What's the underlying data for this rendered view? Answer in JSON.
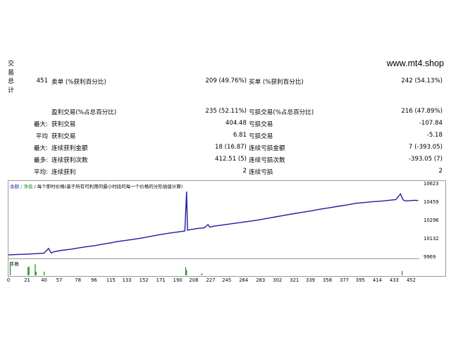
{
  "side_label": "交易总计",
  "brand": "www.mt4.shop",
  "stats": {
    "total_trades": "451",
    "short_label": "卖单 (%获利百分比)",
    "short_value": "209 (49.76%)",
    "long_label": "买单 (%获利百分比)",
    "long_value": "242 (54.13%)",
    "profit_trades_label": "盈利交易(%占总百分比)",
    "profit_trades_value": "235 (52.11%)",
    "loss_trades_label": "亏损交易(%占总百分比)",
    "loss_trades_value": "216 (47.89%)",
    "largest_label": "最大:",
    "largest_profit_label": "获利交易",
    "largest_profit_value": "404.48",
    "largest_loss_label": "亏损交易",
    "largest_loss_value": "-107.84",
    "average_label": "平均",
    "average_profit_label": "获利交易",
    "average_profit_value": "6.81",
    "average_loss_label": "亏损交易",
    "average_loss_value": "-5.18",
    "max_label": "最大:",
    "max_consec_wins_label": "连续获利金额",
    "max_consec_wins_value": "18 (16.87)",
    "max_consec_losses_label": "连续亏损金额",
    "max_consec_losses_value": "7 (-393.05)",
    "maximal_label": "最多:",
    "maximal_consec_profit_label": "连续获利次数",
    "maximal_consec_profit_value": "412.51 (5)",
    "maximal_consec_loss_label": "连续亏损次数",
    "maximal_consec_loss_value": "-393.05 (7)",
    "avg_label": "平均:",
    "avg_consec_wins_label": "连续获利",
    "avg_consec_wins_value": "2",
    "avg_consec_losses_label": "连续亏损",
    "avg_consec_losses_value": "2"
  },
  "legend": {
    "balance": "余额",
    "sep": "/",
    "equity": "净值",
    "desc": "/ 每个即时价格(基于所有可利用的最小时段的每一个价格的分形插值计算)"
  },
  "volume_label": "手数",
  "colors": {
    "balance": "#1c1ca0",
    "equity": "#1a8a1a",
    "volume": "#1a8a1a"
  },
  "chart_data": {
    "type": "line",
    "x_ticks": [
      "0",
      "21",
      "40",
      "57",
      "78",
      "96",
      "115",
      "133",
      "152",
      "171",
      "190",
      "208",
      "227",
      "245",
      "264",
      "283",
      "302",
      "321",
      "339",
      "358",
      "377",
      "395",
      "414",
      "433",
      "452"
    ],
    "y_ticks": [
      "10623",
      "10459",
      "10296",
      "10132",
      "9969"
    ],
    "ylim": [
      9969,
      10623
    ],
    "xlim": [
      0,
      462
    ],
    "series": [
      {
        "x": [
          0,
          10,
          20,
          30,
          40,
          45,
          48,
          50,
          55,
          60,
          70,
          80,
          90,
          96,
          100,
          105,
          110,
          115,
          120,
          125,
          130,
          140,
          150,
          160,
          170,
          180,
          190,
          195,
          198,
          200,
          201,
          205,
          208,
          210,
          220,
          224,
          226,
          230,
          240,
          250,
          260,
          270,
          280,
          290,
          300,
          310,
          320,
          330,
          340,
          350,
          360,
          370,
          380,
          390,
          400,
          410,
          420,
          430,
          435,
          440,
          443,
          446,
          450,
          455,
          460
        ],
        "y": [
          9995,
          9998,
          10001,
          10005,
          10010,
          10052,
          10011,
          10020,
          10028,
          10035,
          10045,
          10058,
          10070,
          10075,
          10082,
          10089,
          10096,
          10102,
          10110,
          10116,
          10122,
          10133,
          10146,
          10160,
          10175,
          10188,
          10199,
          10204,
          10208,
          10560,
          10215,
          10222,
          10224,
          10228,
          10237,
          10265,
          10242,
          10250,
          10261,
          10272,
          10283,
          10294,
          10305,
          10320,
          10334,
          10348,
          10362,
          10375,
          10388,
          10402,
          10415,
          10428,
          10440,
          10455,
          10462,
          10470,
          10476,
          10484,
          10488,
          10540,
          10486,
          10476,
          10478,
          10482,
          10480
        ]
      }
    ],
    "volume_bars": [
      {
        "x": 2,
        "v": 0.9
      },
      {
        "x": 22,
        "v": 0.55
      },
      {
        "x": 23,
        "v": 0.6
      },
      {
        "x": 30,
        "v": 0.75
      },
      {
        "x": 31,
        "v": 0.25
      },
      {
        "x": 40,
        "v": 0.25
      },
      {
        "x": 199,
        "v": 0.55
      },
      {
        "x": 200,
        "v": 0.35
      },
      {
        "x": 217,
        "v": 0.15
      },
      {
        "x": 442,
        "v": 0.3
      }
    ]
  }
}
